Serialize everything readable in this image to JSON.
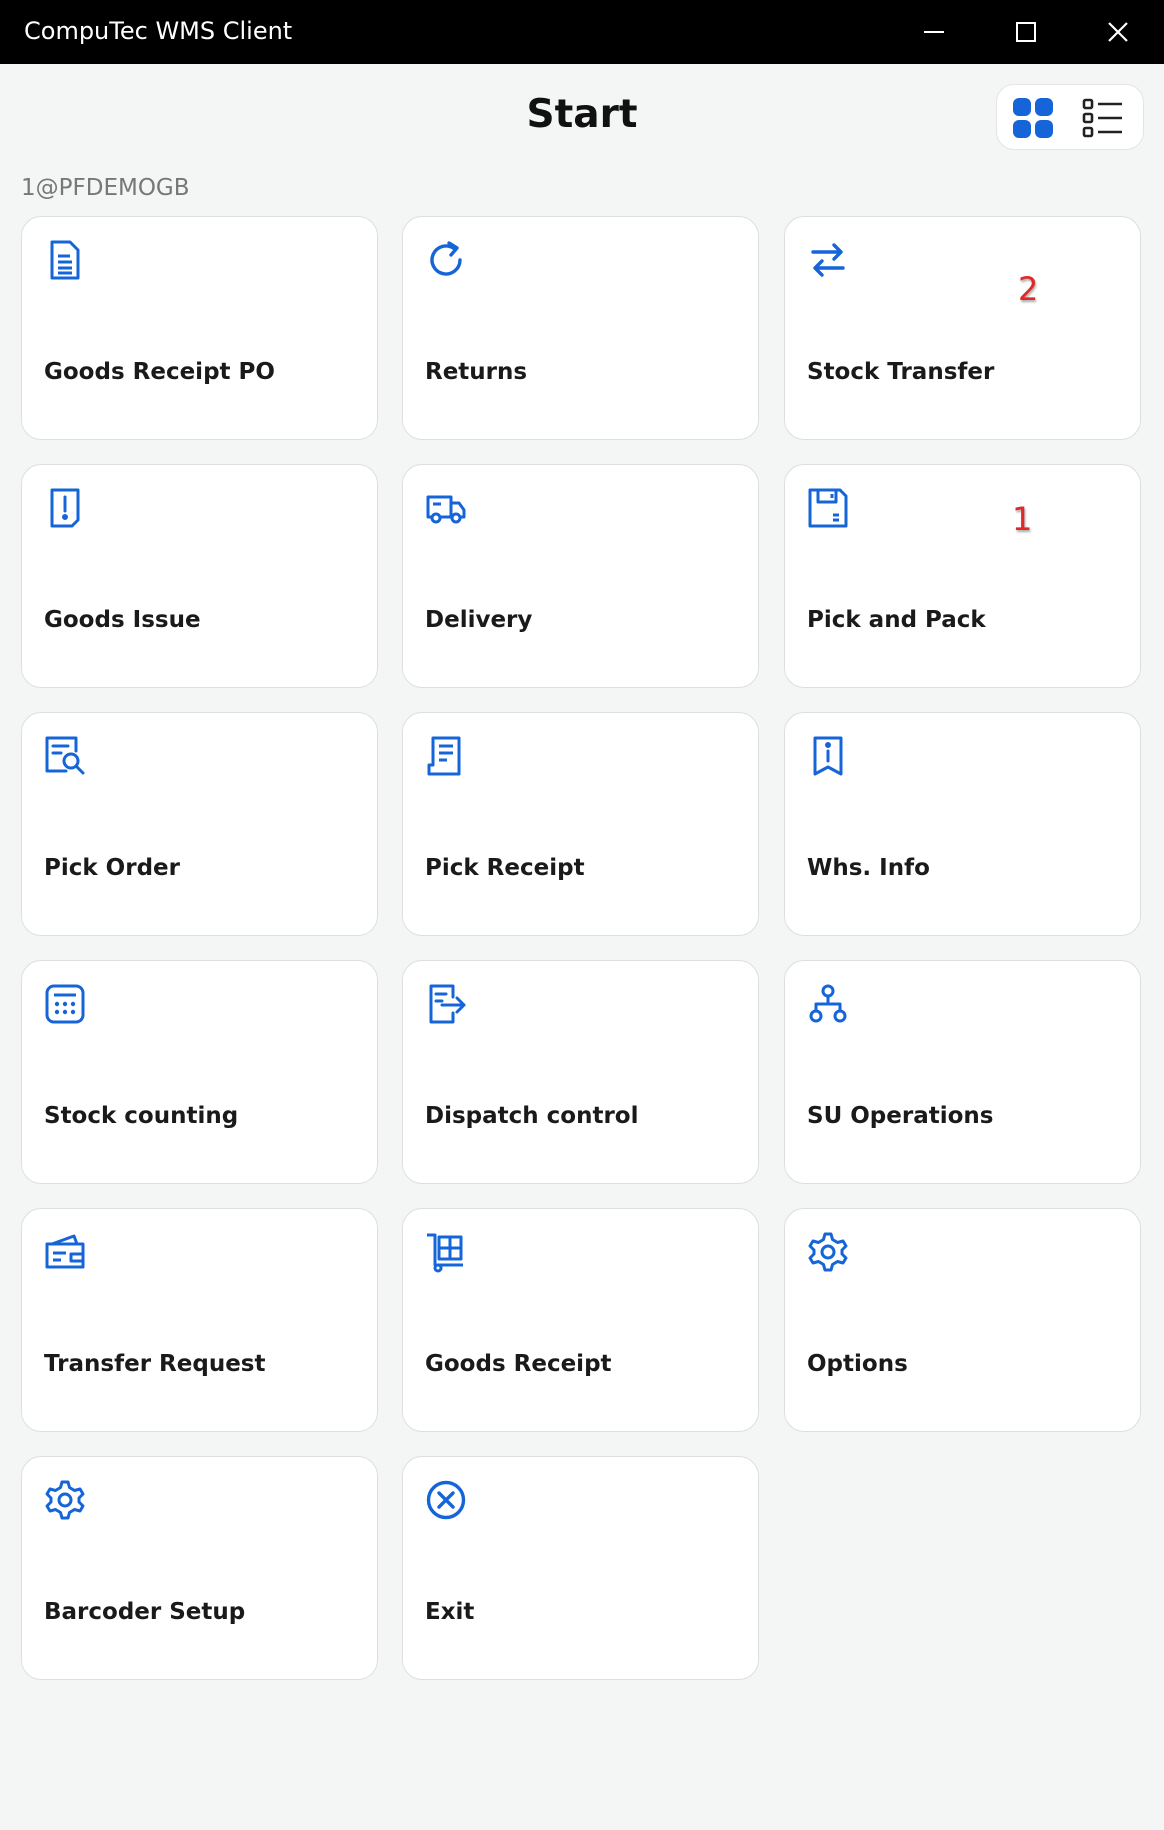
{
  "window": {
    "title": "CompuTec WMS Client",
    "controls": [
      "minimize-icon",
      "maximize-icon",
      "close-icon"
    ]
  },
  "header": {
    "title": "Start",
    "view_toggle": [
      "grid-view-icon",
      "list-view-icon"
    ]
  },
  "user": "1@PFDEMOGB",
  "accent_color": "#1565d8",
  "tiles": [
    {
      "label": "Goods Receipt PO",
      "icon": "document-icon"
    },
    {
      "label": "Returns",
      "icon": "refresh-icon"
    },
    {
      "label": "Stock Transfer",
      "icon": "transfer-arrows-icon"
    },
    {
      "label": "Goods Issue",
      "icon": "document-alert-icon"
    },
    {
      "label": "Delivery",
      "icon": "truck-icon"
    },
    {
      "label": "Pick and Pack",
      "icon": "floppy-disk-icon"
    },
    {
      "label": "Pick Order",
      "icon": "document-search-icon"
    },
    {
      "label": "Pick Receipt",
      "icon": "receipt-icon"
    },
    {
      "label": "Whs. Info",
      "icon": "document-info-icon"
    },
    {
      "label": "Stock counting",
      "icon": "calculator-icon"
    },
    {
      "label": "Dispatch control",
      "icon": "document-export-icon"
    },
    {
      "label": "SU Operations",
      "icon": "hierarchy-icon"
    },
    {
      "label": "Transfer Request",
      "icon": "wallet-icon"
    },
    {
      "label": "Goods Receipt",
      "icon": "hand-truck-icon"
    },
    {
      "label": "Options",
      "icon": "gear-icon"
    },
    {
      "label": "Barcoder Setup",
      "icon": "gear-icon"
    },
    {
      "label": "Exit",
      "icon": "close-circle-icon"
    }
  ],
  "annotations": [
    "2",
    "1"
  ]
}
